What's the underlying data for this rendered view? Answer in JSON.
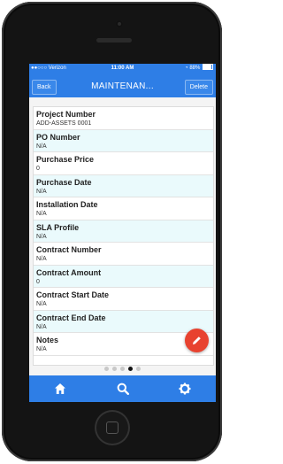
{
  "status_bar": {
    "carrier": "●●○○○ Verizon",
    "time": "11:00 AM",
    "battery_percent": "88%",
    "battery_level": 0.88
  },
  "nav": {
    "back_label": "Back",
    "title": "MAINTENAN...",
    "delete_label": "Delete"
  },
  "fields": [
    {
      "label": "Project Number",
      "value": "ADD-ASSETS 0001"
    },
    {
      "label": "PO Number",
      "value": "N/A"
    },
    {
      "label": "Purchase Price",
      "value": "0"
    },
    {
      "label": "Purchase Date",
      "value": "N/A"
    },
    {
      "label": "Installation Date",
      "value": "N/A"
    },
    {
      "label": "SLA Profile",
      "value": "N/A"
    },
    {
      "label": "Contract Number",
      "value": "N/A"
    },
    {
      "label": "Contract Amount",
      "value": "0"
    },
    {
      "label": "Contract Start Date",
      "value": "N/A"
    },
    {
      "label": "Contract End Date",
      "value": "N/A"
    },
    {
      "label": "Notes",
      "value": "N/A"
    }
  ],
  "pagination": {
    "total": 5,
    "active": 4
  },
  "fab_icon": "pencil-icon",
  "tabs": [
    {
      "name": "home-icon"
    },
    {
      "name": "search-icon"
    },
    {
      "name": "gear-icon"
    }
  ],
  "colors": {
    "accent": "#2e7ee6",
    "fab": "#e8422f",
    "alt_row": "#eafafc"
  }
}
